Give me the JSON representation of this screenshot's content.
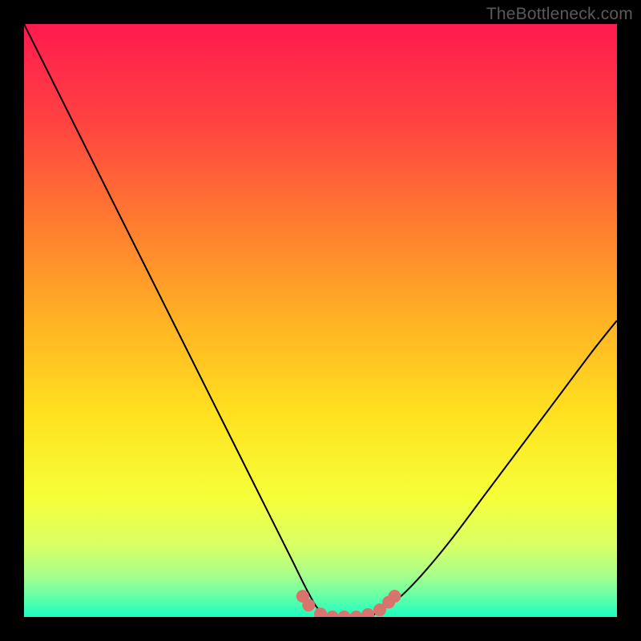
{
  "watermark": "TheBottleneck.com",
  "chart_data": {
    "type": "line",
    "title": "",
    "xlabel": "",
    "ylabel": "",
    "xlim": [
      0,
      100
    ],
    "ylim": [
      0,
      100
    ],
    "series": [
      {
        "name": "curve",
        "x": [
          0,
          5,
          10,
          15,
          20,
          25,
          30,
          35,
          40,
          45,
          48,
          50,
          53,
          56,
          58,
          60,
          63,
          67,
          72,
          78,
          84,
          90,
          96,
          100
        ],
        "y": [
          100,
          90,
          80,
          70,
          60,
          50,
          40,
          30,
          20,
          10,
          4,
          1,
          0,
          0,
          0,
          1,
          3,
          7,
          13,
          21,
          29,
          37,
          45,
          50
        ]
      }
    ],
    "markers": {
      "name": "valley-markers",
      "color": "#d9746c",
      "points": [
        {
          "x": 47,
          "y": 3.5
        },
        {
          "x": 48,
          "y": 2
        },
        {
          "x": 50,
          "y": 0.5
        },
        {
          "x": 52,
          "y": 0
        },
        {
          "x": 54,
          "y": 0
        },
        {
          "x": 56,
          "y": 0
        },
        {
          "x": 58,
          "y": 0.4
        },
        {
          "x": 60,
          "y": 1.2
        },
        {
          "x": 61.5,
          "y": 2.5
        },
        {
          "x": 62.5,
          "y": 3.5
        }
      ]
    },
    "background_gradient": {
      "type": "vertical",
      "stops": [
        {
          "pos": 0.0,
          "color": "#ff1a4f"
        },
        {
          "pos": 0.17,
          "color": "#ff4440"
        },
        {
          "pos": 0.34,
          "color": "#ff7d2f"
        },
        {
          "pos": 0.5,
          "color": "#ffb224"
        },
        {
          "pos": 0.66,
          "color": "#ffe21f"
        },
        {
          "pos": 0.8,
          "color": "#f6ff3a"
        },
        {
          "pos": 0.88,
          "color": "#d9ff66"
        },
        {
          "pos": 0.93,
          "color": "#a6ff8a"
        },
        {
          "pos": 0.97,
          "color": "#5cffab"
        },
        {
          "pos": 1.0,
          "color": "#1affc0"
        }
      ]
    }
  }
}
